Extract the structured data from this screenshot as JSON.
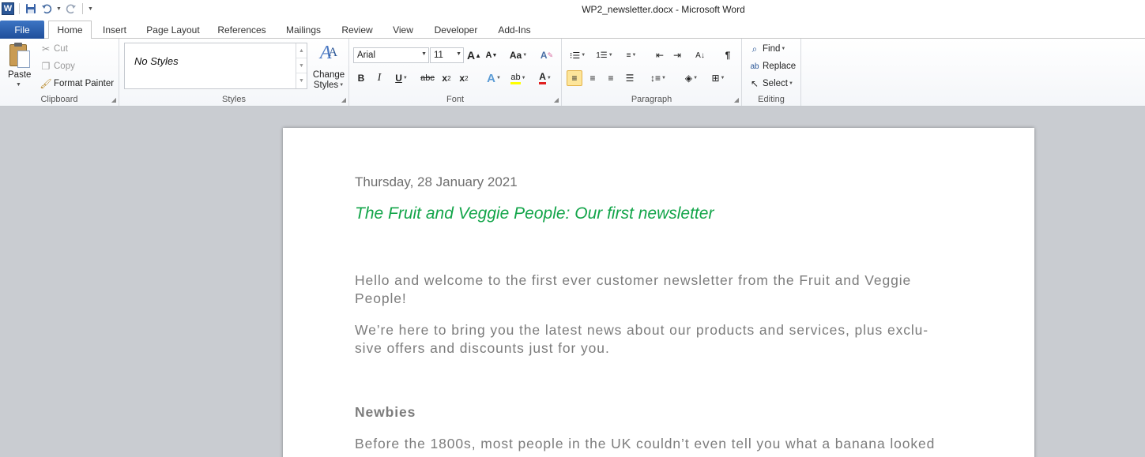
{
  "window": {
    "title": "WP2_newsletter.docx  -  Microsoft Word"
  },
  "qat": {
    "app_icon": "W"
  },
  "tabs": [
    "File",
    "Home",
    "Insert",
    "Page Layout",
    "References",
    "Mailings",
    "Review",
    "View",
    "Developer",
    "Add-Ins"
  ],
  "clipboard": {
    "paste": "Paste",
    "cut": "Cut",
    "copy": "Copy",
    "format_painter": "Format Painter",
    "label": "Clipboard"
  },
  "styles": {
    "current": "No Styles",
    "change_styles_line1": "Change",
    "change_styles_line2": "Styles",
    "label": "Styles"
  },
  "font": {
    "name": "Arial",
    "size": "11",
    "label": "Font"
  },
  "paragraph": {
    "label": "Paragraph"
  },
  "editing": {
    "find": "Find",
    "replace": "Replace",
    "select": "Select",
    "label": "Editing"
  },
  "document": {
    "date": "Thursday, 28 January 2021",
    "headline": "The Fruit and Veggie People: Our first newsletter",
    "para1_line1": "Hello and welcome to the first ever customer newsletter from the Fruit and Veggie",
    "para1_line2": "People!",
    "para2_line1": "We’re here to bring you the latest news about our products and services, plus exclu-",
    "para2_line2": "sive offers and discounts just for you.",
    "subhead": "Newbies",
    "para3_line1": "Before the 1800s, most people in the UK couldn’t even tell you what a banana looked"
  },
  "colors": {
    "headline": "#13a54a",
    "body_text": "#7c7c7c",
    "file_tab": "#2a5ea8"
  }
}
